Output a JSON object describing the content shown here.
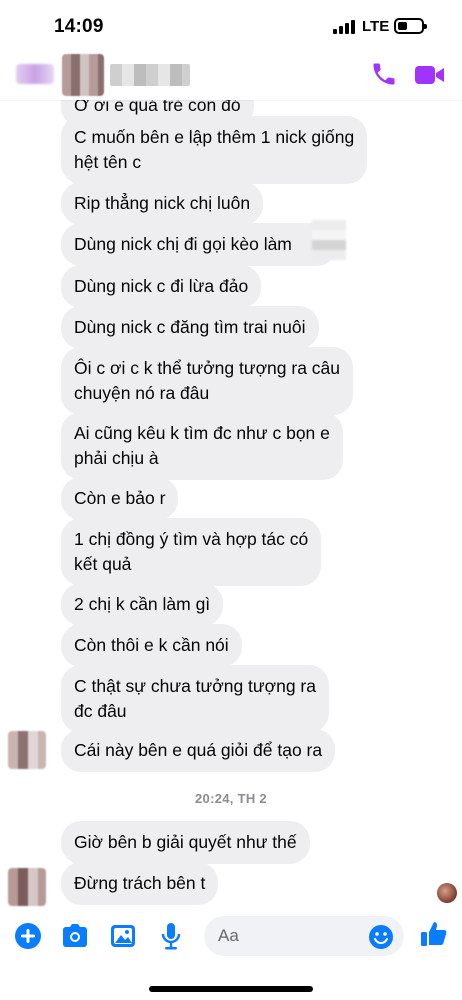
{
  "status_bar": {
    "time": "14:09",
    "network": "LTE"
  },
  "header": {
    "contact_name": "",
    "actions": [
      "phone-icon",
      "video-icon"
    ],
    "accent_color": "#a033ff"
  },
  "thread": {
    "messages": [
      {
        "text": "Ơ ơi e quá trẻ con đó"
      },
      {
        "text": "C muốn bên e lập thêm 1 nick giống\nhệt tên c"
      },
      {
        "text": "Rip thẳng nick chị luôn"
      },
      {
        "text": "Dùng nick chị đi gọi kèo làm"
      },
      {
        "text": "Dùng nick c đi lừa đảo"
      },
      {
        "text": "Dùng nick c đăng tìm trai nuôi"
      },
      {
        "text": "Ôi c ơi c k thể tưởng tượng ra câu\nchuyện nó ra đâu"
      },
      {
        "text": "Ai cũng kêu k tìm đc như c bọn e\nphải chịu à"
      },
      {
        "text": "Còn e bảo r"
      },
      {
        "text": "1 chị đồng ý tìm và hợp tác có\nkết quả"
      },
      {
        "text": "2 chị k cần làm gì"
      },
      {
        "text": "Còn thôi e k cần nói"
      },
      {
        "text": "C thật sự chưa tưởng tượng ra\nđc đâu"
      },
      {
        "text": "Cái này bên e quá giỏi để tạo ra"
      }
    ],
    "timestamp": "20:24, TH 2",
    "messages_after": [
      {
        "text": "Giờ bên b giải quyết như thế"
      },
      {
        "text": "Đừng trách bên t"
      }
    ],
    "bubble_color": "#eeeef1"
  },
  "composer": {
    "placeholder": "Aa",
    "icons": [
      "plus-icon",
      "camera-icon",
      "image-icon",
      "microphone-icon",
      "emoji-icon",
      "like-icon"
    ],
    "icon_color": "#0a7cff"
  }
}
